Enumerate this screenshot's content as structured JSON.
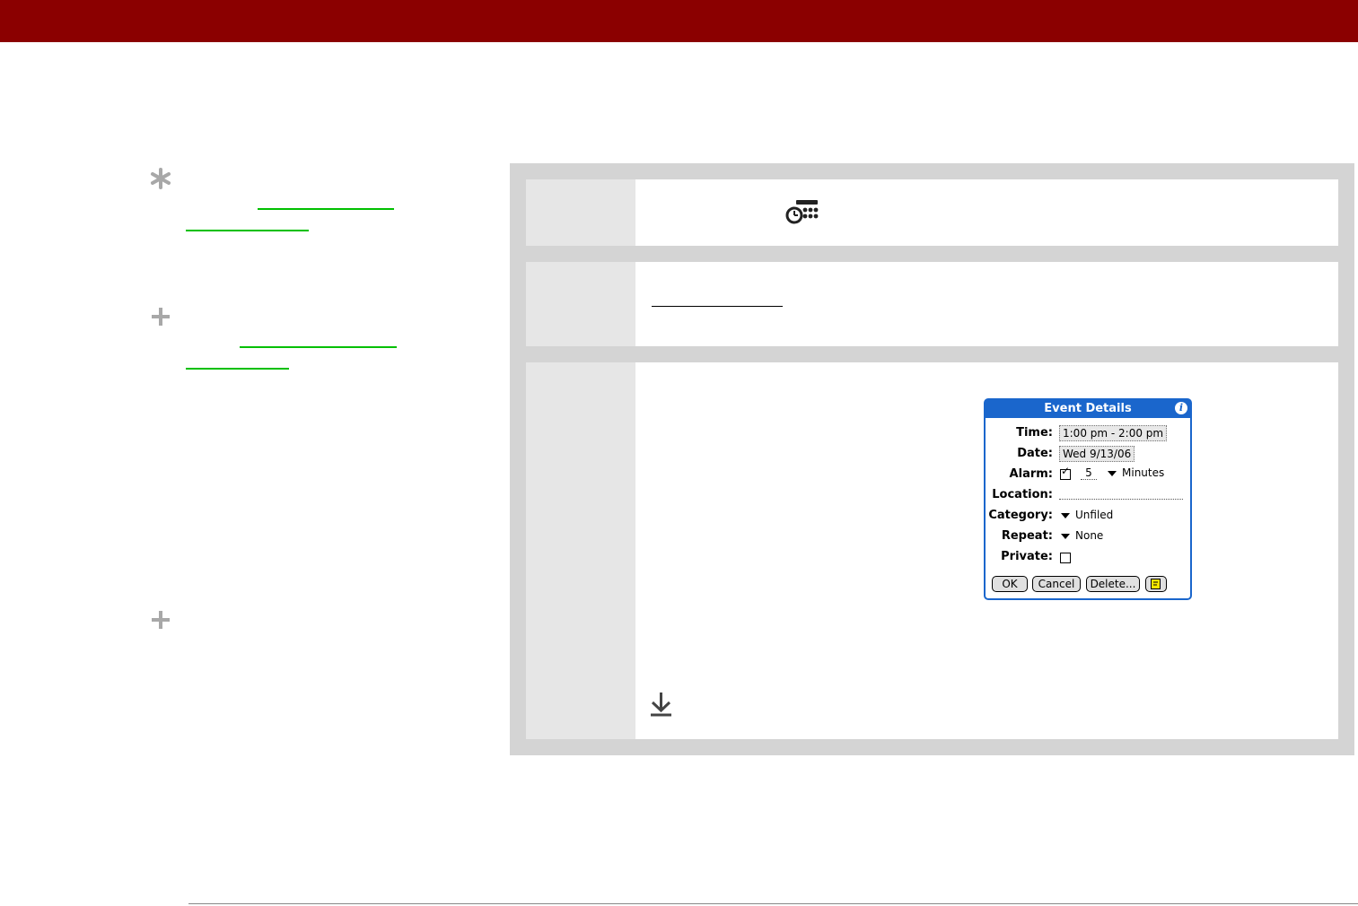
{
  "dialog": {
    "title": "Event Details",
    "info_glyph": "i",
    "fields": {
      "time_label": "Time:",
      "time_value": "1:00 pm - 2:00 pm",
      "date_label": "Date:",
      "date_value": "Wed 9/13/06",
      "alarm_label": "Alarm:",
      "alarm_checked_glyph": "✓",
      "alarm_amount": "5",
      "alarm_unit": "Minutes",
      "location_label": "Location:",
      "category_label": "Category:",
      "category_value": "Unfiled",
      "repeat_label": "Repeat:",
      "repeat_value": "None",
      "private_label": "Private:"
    },
    "buttons": {
      "ok": "OK",
      "cancel": "Cancel",
      "delete": "Delete..."
    }
  },
  "icons": {
    "sidebar_tip": "asterisk-icon",
    "sidebar_more_1": "plus-icon",
    "sidebar_more_2": "plus-icon",
    "app_icon": "clock-menu-icon",
    "continue_icon": "download-arrow-icon",
    "note_icon": "note-icon"
  },
  "colors": {
    "topbar": "#8b0000",
    "link": "#00c000",
    "dialog_accent": "#1a66cc"
  }
}
